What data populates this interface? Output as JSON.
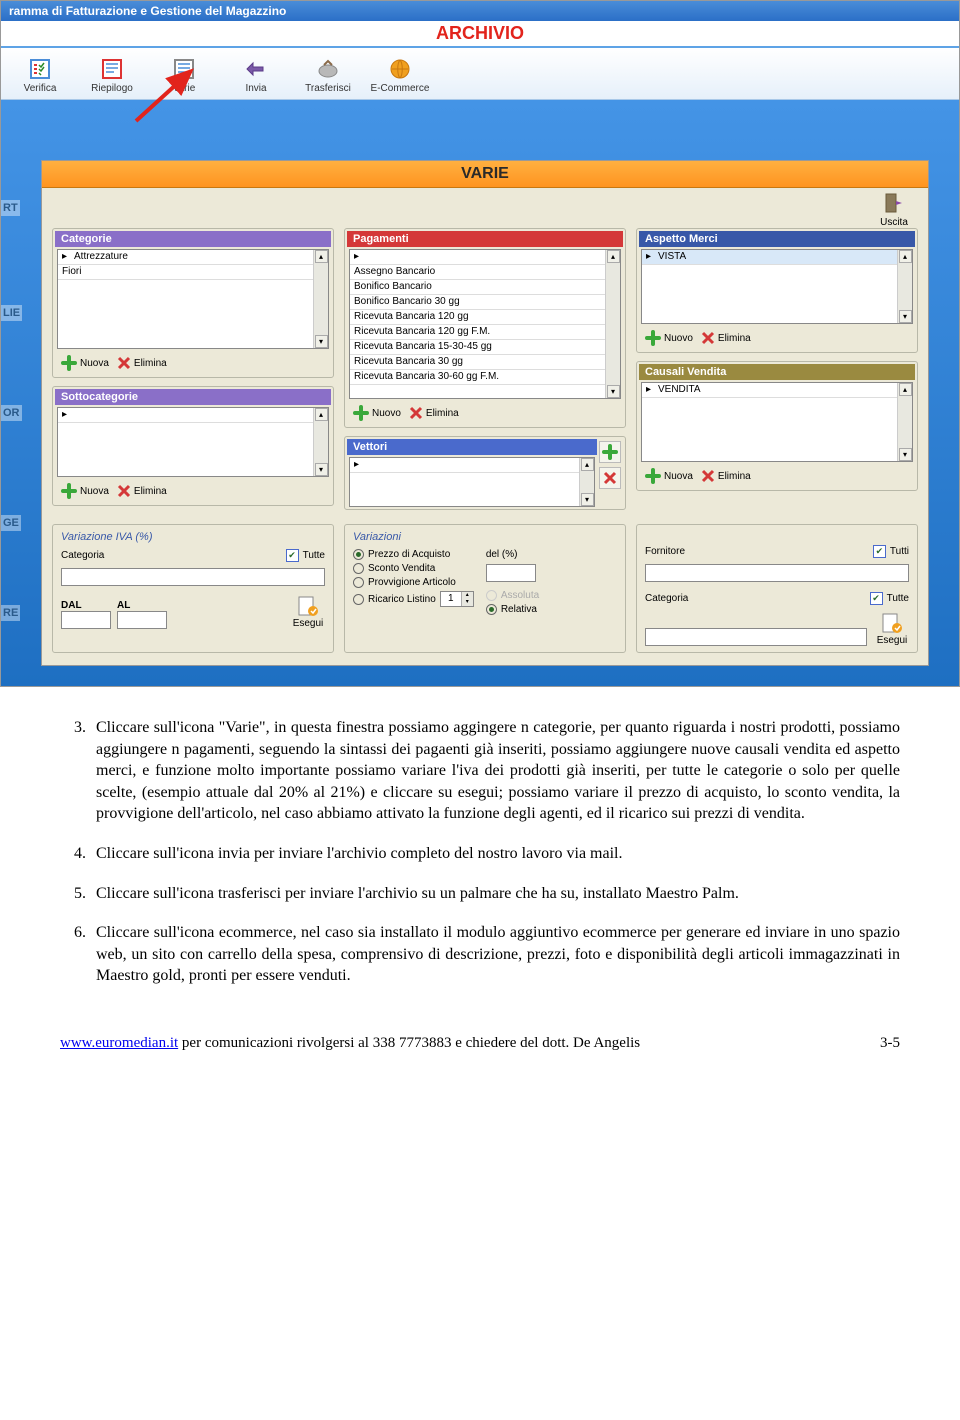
{
  "titlebar": "ramma di Fatturazione e Gestione del Magazzino",
  "archivio_label": "ARCHIVIO",
  "toolbar": [
    {
      "label": "Verifica"
    },
    {
      "label": "Riepilogo"
    },
    {
      "label": "Varie"
    },
    {
      "label": "Invia"
    },
    {
      "label": "Trasferisci"
    },
    {
      "label": "E-Commerce"
    }
  ],
  "varie_header": "VARIE",
  "uscita_label": "Uscita",
  "groups": {
    "categorie": {
      "title": "Categorie",
      "items": [
        "Attrezzature",
        "Fiori"
      ],
      "new": "Nuova",
      "del": "Elimina"
    },
    "sottocategorie": {
      "title": "Sottocategorie",
      "items": [
        ""
      ],
      "new": "Nuova",
      "del": "Elimina"
    },
    "pagamenti": {
      "title": "Pagamenti",
      "items": [
        "",
        "Assegno Bancario",
        "Bonifico Bancario",
        "Bonifico Bancario 30 gg",
        "Ricevuta Bancaria 120 gg",
        "Ricevuta Bancaria 120 gg F.M.",
        "Ricevuta Bancaria 15-30-45 gg",
        "Ricevuta Bancaria 30 gg",
        "Ricevuta Bancaria 30-60 gg F.M."
      ],
      "new": "Nuovo",
      "del": "Elimina"
    },
    "vettori": {
      "title": "Vettori",
      "items": [
        ""
      ]
    },
    "aspetto": {
      "title": "Aspetto Merci",
      "items": [
        "VISTA"
      ],
      "new": "Nuovo",
      "del": "Elimina"
    },
    "causali": {
      "title": "Causali Vendita",
      "items": [
        "VENDITA"
      ],
      "new": "Nuova",
      "del": "Elimina"
    }
  },
  "variazione_iva": {
    "title": "Variazione IVA (%)",
    "categoria": "Categoria",
    "tutte": "Tutte",
    "dal": "DAL",
    "al": "AL",
    "esegui": "Esegui"
  },
  "variazioni": {
    "title": "Variazioni",
    "radios": [
      "Prezzo di Acquisto",
      "Sconto Vendita",
      "Provvigione Articolo",
      "Ricarico Listino"
    ],
    "del_label": "del (%)",
    "assoluta": "Assoluta",
    "relativa": "Relativa",
    "spinner_val": "1"
  },
  "fornitore_box": {
    "fornitore": "Fornitore",
    "tutti": "Tutti",
    "categoria": "Categoria",
    "tutte": "Tutte",
    "esegui": "Esegui"
  },
  "side_stubs": {
    "rt": "RT",
    "lie": "LIE",
    "or": "OR",
    "ge": "GE",
    "re": "RE"
  },
  "doc": {
    "p3": "Cliccare sull'icona \"Varie\", in questa finestra possiamo aggingere n categorie, per quanto riguarda i nostri prodotti, possiamo aggiungere n pagamenti, seguendo la sintassi dei pagaenti già inseriti, possiamo aggiungere nuove causali vendita ed aspetto merci, e funzione molto importante possiamo variare l'iva dei prodotti già inseriti, per tutte le categorie o solo per quelle scelte, (esempio attuale dal 20% al 21%) e cliccare su esegui; possiamo variare il prezzo di acquisto, lo sconto vendita, la provvigione dell'articolo, nel caso abbiamo attivato la funzione degli agenti, ed il ricarico sui prezzi di vendita.",
    "p4": "Cliccare sull'icona invia per inviare l'archivio completo del nostro lavoro via mail.",
    "p5": "Cliccare sull'icona trasferisci per inviare l'archivio su un palmare che ha su, installato Maestro Palm.",
    "p6": "Cliccare sull'icona ecommerce, nel caso sia installato il modulo aggiuntivo ecommerce per generare ed inviare in uno spazio web, un sito con carrello della spesa, comprensivo di descrizione, prezzi, foto e disponibilità degli articoli immagazzinati in Maestro gold, pronti per essere venduti."
  },
  "footer": {
    "link": "www.euromedian.it",
    "text": " per comunicazioni rivolgersi al 338 7773883 e chiedere del dott. De Angelis",
    "page": "3-5"
  }
}
